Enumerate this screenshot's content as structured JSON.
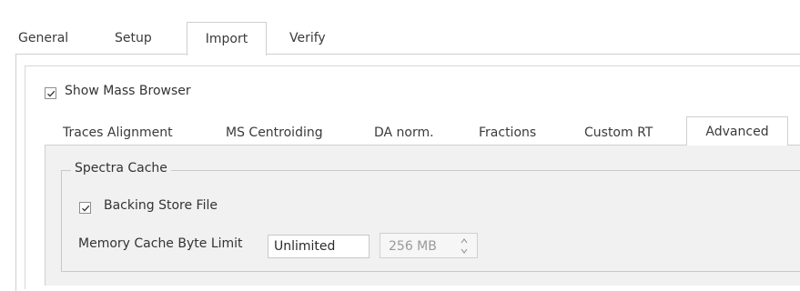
{
  "top_tabs": {
    "general": "General",
    "setup": "Setup",
    "import": "Import",
    "verify": "Verify",
    "active": "Import"
  },
  "show_mass_browser": {
    "label": "Show Mass Browser",
    "checked": true
  },
  "sub_tabs": {
    "traces_alignment": "Traces Alignment",
    "ms_centroiding": "MS Centroiding",
    "da_norm": "DA norm.",
    "fractions": "Fractions",
    "custom_rt": "Custom RT",
    "advanced": "Advanced",
    "active": "Advanced"
  },
  "spectra_cache": {
    "title": "Spectra Cache",
    "backing_store_file": {
      "label": "Backing Store File",
      "checked": true
    },
    "memory_cache_byte_limit": {
      "label": "Memory Cache Byte Limit",
      "selected": "Unlimited",
      "size_value": "256 MB"
    }
  },
  "colors": {
    "border": "#cfcfcf",
    "panel_background": "#f1f1f1",
    "disabled_text": "#9a9a9a"
  },
  "icons": {
    "checkbox": "checkmark-icon",
    "dropdown": "chevron-down-icon",
    "spin_up": "spin-up-icon",
    "spin_down": "spin-down-icon"
  }
}
